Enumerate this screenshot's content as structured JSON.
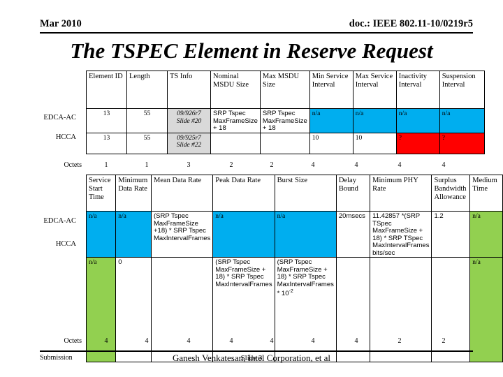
{
  "header": {
    "date": "Mar 2010",
    "doc": "doc.: IEEE 802.11-10/0219r5"
  },
  "title": "The TSPEC Element in Reserve Request",
  "table1": {
    "columns": [
      "Element ID",
      "Length",
      "TS Info",
      "Nominal MSDU Size",
      "Max MSDU Size",
      "Min Service Interval",
      "Max Service Interval",
      "Inactivity Interval",
      "Suspension Interval"
    ],
    "rows": [
      {
        "label": "EDCA-AC",
        "cells": [
          {
            "text": "13",
            "style": "ctr"
          },
          {
            "text": "55",
            "style": "ctr"
          },
          {
            "text": "09/926r7 Slide #20",
            "style": "shade"
          },
          {
            "text": "SRP Tspec MaxFrameSize + 18",
            "style": "sans"
          },
          {
            "text": "SRP Tspec MaxFrameSize + 18",
            "style": "sans"
          },
          {
            "text": "n/a",
            "style": "cyan"
          },
          {
            "text": "n/a",
            "style": "cyan"
          },
          {
            "text": "n/a",
            "style": "cyan"
          },
          {
            "text": "n/a",
            "style": "cyan"
          }
        ]
      },
      {
        "label": "HCCA",
        "cells": [
          {
            "text": "13",
            "style": "ctr"
          },
          {
            "text": "55",
            "style": "ctr"
          },
          {
            "text": "09/925r7 Slide #22",
            "style": "shade"
          },
          {
            "text": "",
            "style": "sans"
          },
          {
            "text": "",
            "style": "sans"
          },
          {
            "text": "10",
            "style": ""
          },
          {
            "text": "10",
            "style": ""
          },
          {
            "text": "?",
            "style": "red"
          },
          {
            "text": "?",
            "style": "red"
          }
        ]
      }
    ],
    "octets_label": "Octets",
    "octets": [
      "1",
      "1",
      "3",
      "2",
      "2",
      "4",
      "4",
      "4",
      "4"
    ]
  },
  "table2": {
    "columns": [
      "Service Start Time",
      "Minimum Data Rate",
      "Mean Data Rate",
      "Peak Data Rate",
      "Burst Size",
      "Delay Bound",
      "Minimum PHY Rate",
      "Surplus Bandwidth Allowance",
      "Medium Time"
    ],
    "rows": [
      {
        "label": "EDCA-AC",
        "cells": [
          {
            "text": "n/a",
            "style": "cyan"
          },
          {
            "text": "n/a",
            "style": "cyan"
          },
          {
            "text": "(SRP Tspec MaxFrameSize +18) * SRP Tspec MaxIntervalFrames",
            "style": "sans"
          },
          {
            "text": "n/a",
            "style": "cyan"
          },
          {
            "text": "n/a",
            "style": "cyan"
          },
          {
            "text": "20msecs",
            "style": "sans"
          },
          {
            "text": "11.42857 *(SRP TSpec MaxFrameSize + 18) * SRP TSpec MaxIntervalFrames bits/sec",
            "style": "sans"
          },
          {
            "text": "1.2",
            "style": "sans"
          },
          {
            "text": "n/a",
            "style": "green"
          }
        ]
      },
      {
        "label": "HCCA",
        "cells": [
          {
            "text": "n/a",
            "style": "green"
          },
          {
            "text": "0",
            "style": "sans"
          },
          {
            "text": "",
            "style": "sans"
          },
          {
            "text": "(SRP Tspec MaxFrameSize + 18) * SRP Tspec MaxIntervalFrames",
            "style": "sans"
          },
          {
            "text": "(SRP Tspec MaxFrameSize + 18) * SRP Tspec MaxIntervalFrames * 10",
            "style": "sans",
            "sup": "-2"
          },
          {
            "text": "",
            "style": "sans"
          },
          {
            "text": "",
            "style": "sans"
          },
          {
            "text": "",
            "style": "sans"
          },
          {
            "text": "n/a",
            "style": "green"
          }
        ]
      }
    ],
    "octets_label": "Octets",
    "octets": [
      "4",
      "4",
      "4",
      "4",
      "4",
      "4",
      "4",
      "2",
      "2"
    ]
  },
  "footer": {
    "left": "Submission",
    "slide": "Slide 3",
    "author": "Ganesh Venkatesan, Intel Corporation, et al"
  }
}
